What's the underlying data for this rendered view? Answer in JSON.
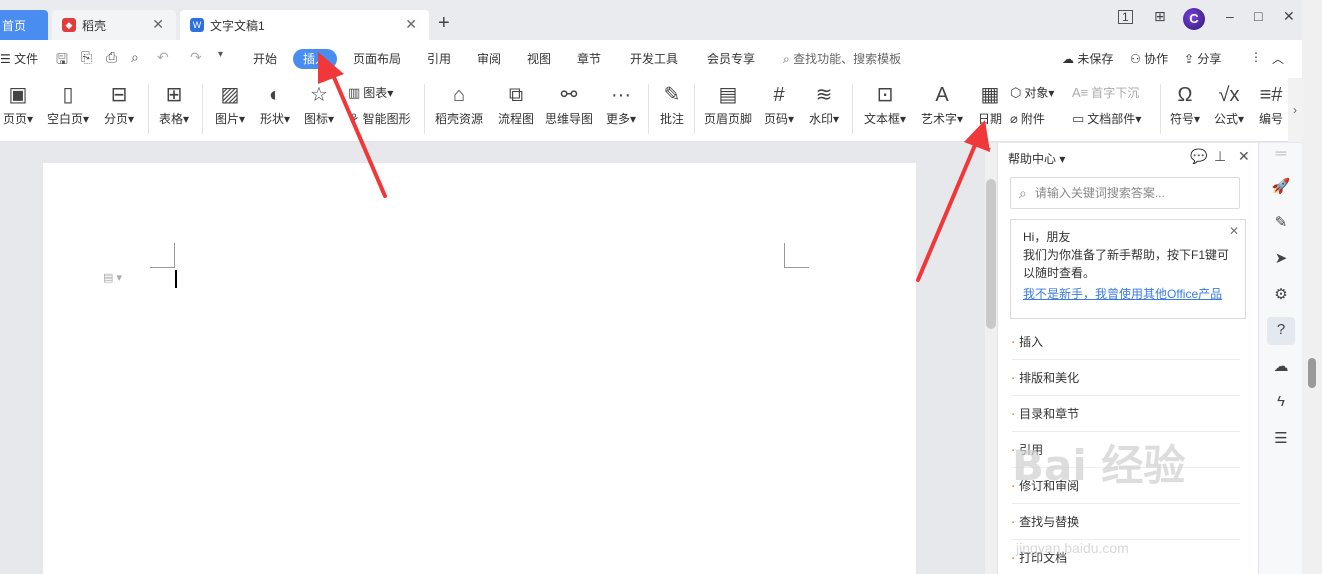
{
  "tabs": {
    "home": "首页",
    "daoke": "稻壳",
    "doc": "文字文稿1",
    "add": "+"
  },
  "window": {
    "minimize": "–",
    "maximize": "□",
    "close": "✕",
    "avatar": "C"
  },
  "menubar": {
    "file": "文件",
    "items": [
      "开始",
      "插入",
      "页面布局",
      "引用",
      "审阅",
      "视图",
      "章节",
      "开发工具",
      "会员专享"
    ],
    "active": "插入",
    "search": "查找功能、搜索模板",
    "unsaved": "未保存",
    "collab": "协作",
    "share": "分享"
  },
  "ribbon": {
    "cover": "页页",
    "blank": "空白页",
    "pagebreak": "分页",
    "table": "表格",
    "picture": "图片",
    "shape": "形状",
    "icon": "图标",
    "chart": "图表",
    "smartart": "智能图形",
    "daoke_res": "稻壳资源",
    "flowchart": "流程图",
    "mindmap": "思维导图",
    "more": "更多",
    "comment": "批注",
    "header_footer": "页眉页脚",
    "page_num": "页码",
    "watermark": "水印",
    "textbox": "文本框",
    "wordart": "艺术字",
    "date": "日期",
    "object": "对象",
    "dropcap": "首字下沉",
    "attachment": "附件",
    "docpart": "文档部件",
    "symbol": "符号",
    "formula": "公式",
    "numbering": "编号"
  },
  "help": {
    "title": "帮助中心",
    "search_placeholder": "请输入关键词搜索答案...",
    "greeting": "Hi，朋友",
    "message": "我们为你准备了新手帮助，按下F1键可以随时查看。",
    "link": "我不是新手，我曾使用其他Office产品",
    "items": [
      "插入",
      "排版和美化",
      "目录和章节",
      "引用",
      "修订和审阅",
      "查找与替换",
      "打印文档"
    ]
  },
  "watermark_text": "Bai 经验",
  "watermark_url": "jingyan.baidu.com",
  "colors": {
    "accent": "#4a8df1",
    "arrow": "#f0383a",
    "link": "#3a7be0"
  }
}
